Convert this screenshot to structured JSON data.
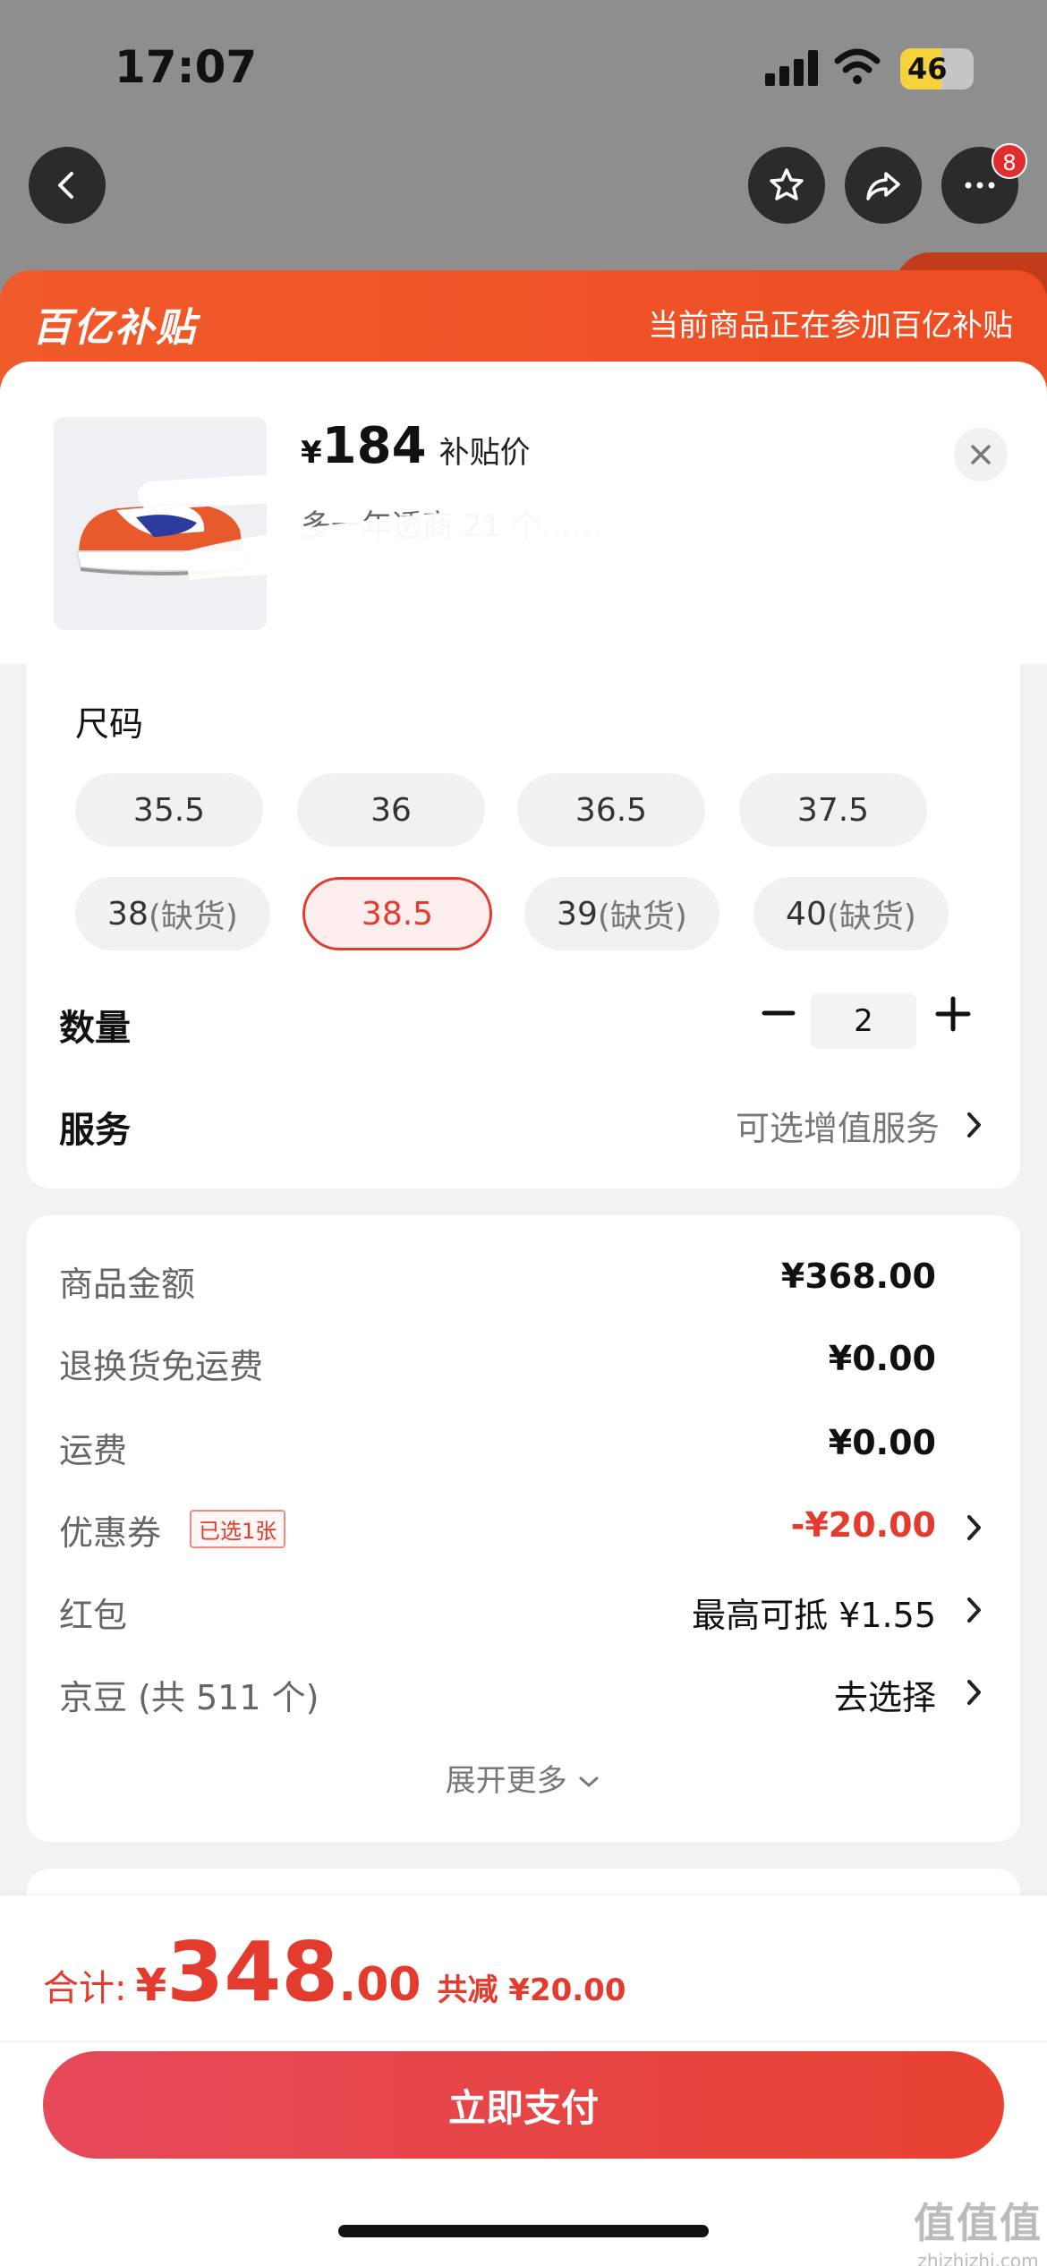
{
  "status_bar": {
    "time": "17:07",
    "battery": "46"
  },
  "nav": {
    "badge_count": "8"
  },
  "subsidy": {
    "logo": "百亿补贴",
    "note": "当前商品正在参加百亿补贴"
  },
  "product": {
    "currency": "¥",
    "price": "184",
    "price_tag": "补贴价",
    "title": "多一年透商 21 个……"
  },
  "options": {
    "size_label": "尺码",
    "sizes": [
      {
        "size": "35.5",
        "note": ""
      },
      {
        "size": "36",
        "note": ""
      },
      {
        "size": "36.5",
        "note": ""
      },
      {
        "size": "37.5",
        "note": ""
      },
      {
        "size": "38",
        "note": "(缺货)"
      },
      {
        "size": "38.5",
        "note": ""
      },
      {
        "size": "39",
        "note": "(缺货)"
      },
      {
        "size": "40",
        "note": "(缺货)"
      }
    ],
    "selected_size": "38.5",
    "quantity_label": "数量",
    "quantity_value": "2",
    "service_label": "服务",
    "service_value": "可选增值服务"
  },
  "summary": {
    "rows": [
      {
        "label": "商品金额",
        "value": "¥368.00"
      },
      {
        "label": "退换货免运费",
        "value": "¥0.00"
      },
      {
        "label": "运费",
        "value": "¥0.00"
      },
      {
        "label": "优惠券",
        "value": "-¥20.00",
        "badge": "已选1张"
      },
      {
        "label": "红包",
        "value": "最高可抵 ¥1.55"
      },
      {
        "label": "京豆 (共 511 个)",
        "value": "去选择"
      }
    ],
    "expand_more": "展开更多"
  },
  "footer": {
    "total_label": "合计:",
    "total_yen": "¥",
    "total_int": "348",
    "total_dec": ".00",
    "total_save": "共减 ¥20.00",
    "pay_button": "立即支付"
  },
  "watermark": {
    "main": "值值值",
    "sub": "zhizhizhi.com"
  },
  "colors": {
    "accent": "#e33b2d",
    "header_orange": "#f15a2a"
  }
}
